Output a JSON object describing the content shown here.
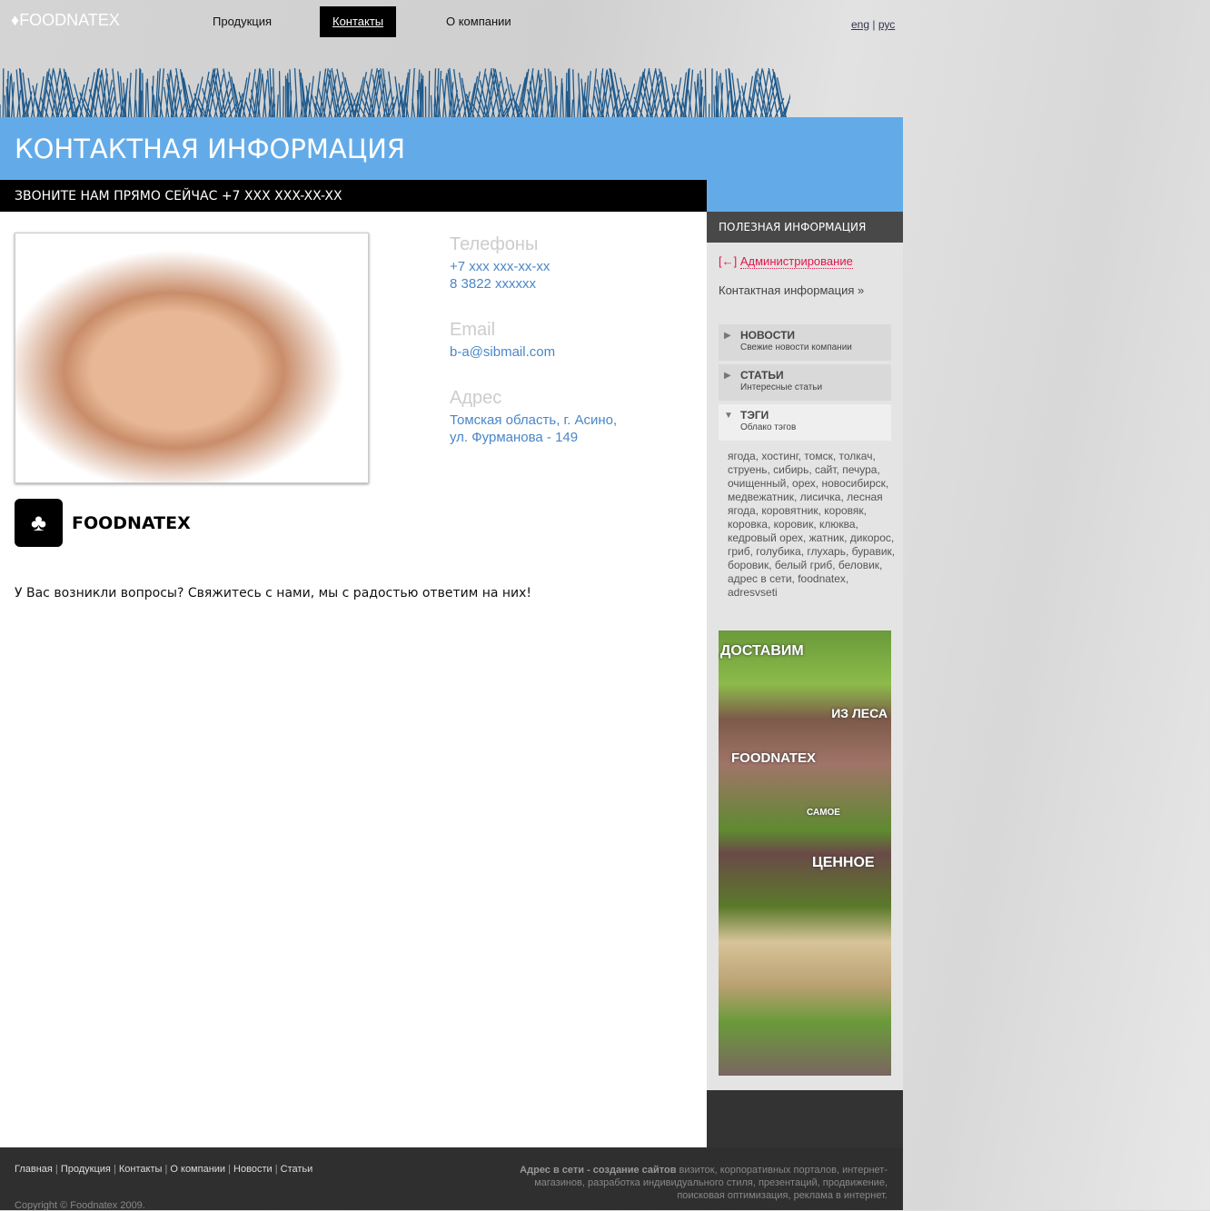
{
  "header": {
    "logo": "FOODNATEX",
    "nav": [
      "Продукция",
      "Контакты",
      "О компании"
    ],
    "active_nav": "Контакты",
    "lang": [
      "eng",
      "рус"
    ]
  },
  "page": {
    "title": "КОНТАКТНАЯ ИНФОРМАЦИЯ",
    "callbar": "ЗВОНИТЕ НАМ ПРЯМО СЕЙЧАС +7 XXX XXX-XX-XX"
  },
  "contacts": {
    "phones_label": "Телефоны",
    "phone1": "+7 xxx xxx-xx-xx",
    "phone2": "8 3822 xxxxxx",
    "email_label": "Email",
    "email": "b-a@sibmail.com",
    "address_label": "Адрес",
    "address1": "Томская область, г. Асино,",
    "address2": "ул. Фурманова - 149"
  },
  "brand": {
    "name": "FOODNATEX"
  },
  "question": "У Вас возникли вопросы? Свяжитесь с нами, мы с радостью ответим на них!",
  "sidebar": {
    "title": "ПОЛЕЗНАЯ ИНФОРМАЦИЯ",
    "admin_prefix": "[←]",
    "admin": "Администрирование",
    "contact_link": "Контактная информация »",
    "sections": [
      {
        "title": "НОВОСТИ",
        "subtitle": "Свежие новости компании"
      },
      {
        "title": "СТАТЬИ",
        "subtitle": "Интересные статьи"
      },
      {
        "title": "ТЭГИ",
        "subtitle": "Облако тэгов"
      }
    ],
    "tags": "ягода, хостинг, томск, толкач, струень, сибирь, сайт, печура, очищенный, орех, новосибирск, медвежатник, лисичка, лесная ягода, коровятник, коровяк, коровка, коровик, клюква, кедровый орех, жатник, дикорос, гриб, голубика, глухарь, буравик, боровик, белый гриб, беловик, адрес в сети, foodnatex, adresvseti",
    "banner": {
      "l1": "ДОСТАВИМ",
      "l2": "ИЗ ЛЕСА",
      "l3": "FOODNATEX",
      "l4": "САМОЕ",
      "l5": "ЦЕННОЕ"
    }
  },
  "footer": {
    "links": [
      "Главная",
      "Продукция",
      "Контакты",
      "О компании",
      "Новости",
      "Статьи"
    ],
    "copyright": "Copyright © Foodnatex 2009.",
    "right_bold": "Адрес в сети - создание сайтов",
    "right_text": " визиток, корпоративных порталов, интернет-магазинов, разработка индивидуального стиля, презентаций, продвижение, поисковая оптимизация, реклама в интернет."
  }
}
